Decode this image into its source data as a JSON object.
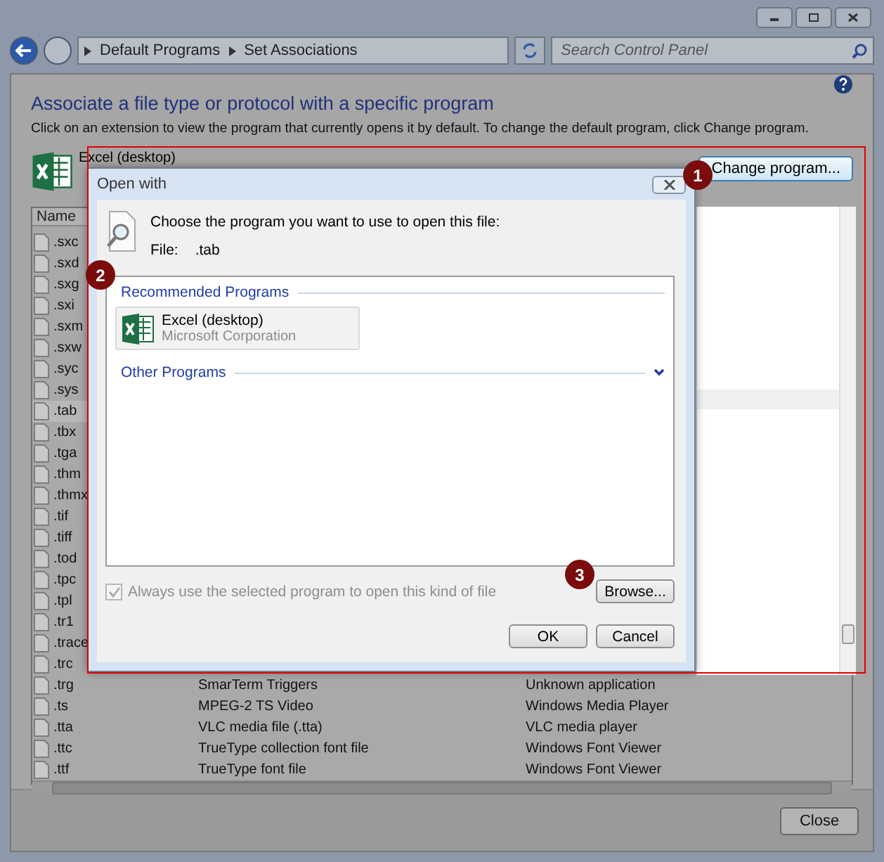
{
  "address_bar": {
    "breadcrumbs": [
      "Default Programs",
      "Set Associations"
    ]
  },
  "search": {
    "placeholder": "Search Control Panel"
  },
  "page": {
    "heading": "Associate a file type or protocol with a specific program",
    "description": "Click on an extension to view the program that currently opens it by default. To change the default program, click Change program.",
    "current_program": "Excel (desktop)",
    "change_button": "Change program..."
  },
  "file_list": {
    "columns": [
      "Name"
    ],
    "rows": [
      {
        "ext": ".sxc",
        "selected": false
      },
      {
        "ext": ".sxd",
        "selected": false
      },
      {
        "ext": ".sxg",
        "selected": false
      },
      {
        "ext": ".sxi",
        "selected": false
      },
      {
        "ext": ".sxm",
        "selected": false
      },
      {
        "ext": ".sxw",
        "selected": false
      },
      {
        "ext": ".syc",
        "selected": false
      },
      {
        "ext": ".sys",
        "selected": false
      },
      {
        "ext": ".tab",
        "selected": true
      },
      {
        "ext": ".tbx",
        "selected": false
      },
      {
        "ext": ".tga",
        "selected": false
      },
      {
        "ext": ".thm",
        "selected": false
      },
      {
        "ext": ".thmx",
        "selected": false
      },
      {
        "ext": ".tif",
        "selected": false
      },
      {
        "ext": ".tiff",
        "selected": false
      },
      {
        "ext": ".tod",
        "selected": false
      },
      {
        "ext": ".tpc",
        "selected": false
      },
      {
        "ext": ".tpl",
        "selected": false
      },
      {
        "ext": ".tr1",
        "selected": false
      },
      {
        "ext": ".trace",
        "selected": false
      },
      {
        "ext": ".trc",
        "selected": false
      },
      {
        "ext": ".trg",
        "description": "SmarTerm Triggers",
        "program": "Unknown application",
        "selected": false
      },
      {
        "ext": ".ts",
        "description": "MPEG-2 TS Video",
        "program": "Windows Media Player",
        "selected": false
      },
      {
        "ext": ".tta",
        "description": "VLC media file (.tta)",
        "program": "VLC media player",
        "selected": false
      },
      {
        "ext": ".ttc",
        "description": "TrueType collection font file",
        "program": "Windows Font Viewer",
        "selected": false
      },
      {
        "ext": ".ttf",
        "description": "TrueType font file",
        "program": "Windows Font Viewer",
        "selected": false
      }
    ]
  },
  "close_button": "Close",
  "dialog": {
    "title": "Open with",
    "prompt": "Choose the program you want to use to open this file:",
    "file_label": "File:",
    "file_name": ".tab",
    "recommended_heading": "Recommended Programs",
    "recommended": [
      {
        "name": "Excel (desktop)",
        "publisher": "Microsoft Corporation"
      }
    ],
    "other_heading": "Other Programs",
    "other_expanded": false,
    "always_use": {
      "label": "Always use the selected program to open this kind of file",
      "checked": true,
      "disabled": true
    },
    "browse_button": "Browse...",
    "ok_button": "OK",
    "cancel_button": "Cancel"
  },
  "callouts": [
    {
      "label": "1"
    },
    {
      "label": "2"
    },
    {
      "label": "3"
    }
  ]
}
